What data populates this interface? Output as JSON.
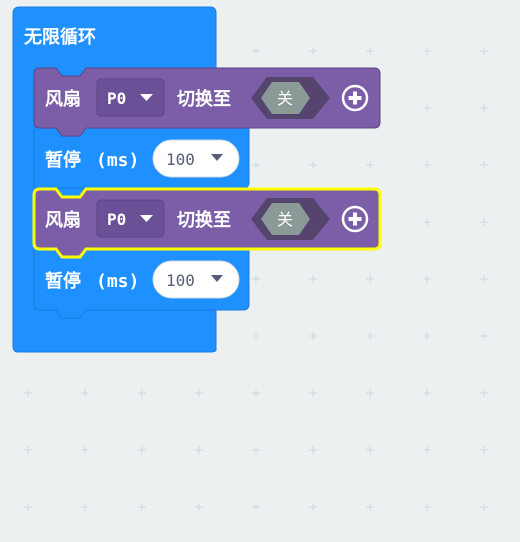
{
  "colors": {
    "workspace_bg": "#ecf0f1",
    "loop_blue": "#1e90ff",
    "loop_blue_border": "#1b7ddb",
    "fan_purple": "#7b5ea7",
    "fan_purple_dark": "#5c4583",
    "selected_outline": "#ffff00",
    "hex_toggle": "#8c9a97",
    "hex_toggle_dark": "#55456e"
  },
  "loop": {
    "label": "无限循环"
  },
  "blocks": [
    {
      "type": "fan",
      "label": "风扇",
      "pin": "P0",
      "action_label": "切换至",
      "state": "关",
      "add_icon": "plus-circle-icon",
      "dropdown_icon": "caret-down-icon"
    },
    {
      "type": "pause",
      "label": "暂停",
      "unit": "(ms)",
      "value": "100",
      "dropdown_icon": "caret-down-icon"
    },
    {
      "type": "fan",
      "label": "风扇",
      "pin": "P0",
      "action_label": "切换至",
      "state": "关",
      "selected": true,
      "add_icon": "plus-circle-icon",
      "dropdown_icon": "caret-down-icon"
    },
    {
      "type": "pause",
      "label": "暂停",
      "unit": "(ms)",
      "value": "100",
      "dropdown_icon": "caret-down-icon"
    }
  ]
}
